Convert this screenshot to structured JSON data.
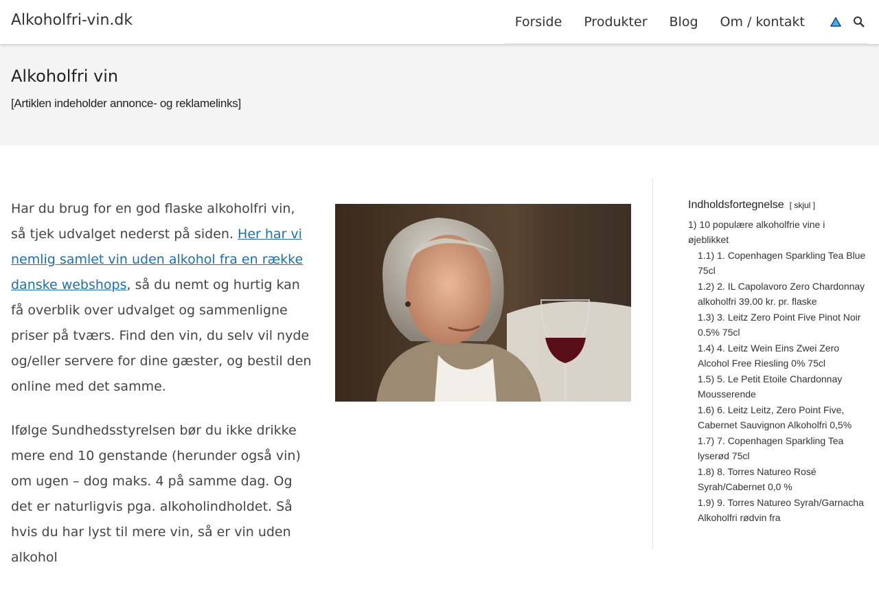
{
  "header": {
    "site_title": "Alkoholfri-vin.dk",
    "nav": [
      "Forside",
      "Produkter",
      "Blog",
      "Om / kontakt"
    ],
    "icons": {
      "alert": "warning-icon",
      "search": "search-icon"
    }
  },
  "hero": {
    "title": "Alkoholfri vin",
    "disclaimer": "[Artiklen indeholder annonce- og reklamelinks]"
  },
  "article": {
    "p1_before": "Har du brug for en god flaske alkoholfri vin, så tjek udvalget nederst på siden. ",
    "p1_link": "Her har vi nemlig samlet vin uden alkohol fra en række danske webshops",
    "p1_after": ", så du nemt og hurtig kan få overblik over udvalget og sammenligne priser på tværs. Find den vin, du selv vil nyde og/eller servere for dine gæster, og bestil den online med det samme.",
    "p2": "Ifølge Sundhedsstyrelsen bør du ikke drikke mere end 10 genstande (herunder også vin) om ugen – dog maks. 4 på samme dag. Og det er naturligvis pga. alkoholindholdet. Så hvis du har lyst til mere vin, så er vin uden alkohol"
  },
  "toc": {
    "title": "Indholdsfortegnelse",
    "toggle_open": "[",
    "toggle_label": "skjul",
    "toggle_close": "]",
    "items": [
      {
        "num": "1)",
        "text": "10 populære alkoholfrie vine i øjeblikket",
        "level": 1
      },
      {
        "num": "1.1)",
        "text": "1. Copenhagen Sparkling Tea Blue 75cl",
        "level": 2
      },
      {
        "num": "1.2)",
        "text": "2. IL Capolavoro Zero Chardonnay alkoholfri 39.00 kr. pr. flaske",
        "level": 2
      },
      {
        "num": "1.3)",
        "text": "3. Leitz Zero Point Five Pinot Noir 0.5% 75cl",
        "level": 2
      },
      {
        "num": "1.4)",
        "text": "4. Leitz Wein Eins Zwei Zero Alcohol Free Riesling 0% 75cl",
        "level": 2
      },
      {
        "num": "1.5)",
        "text": "5. Le Petit Etoile Chardonnay Mousserende",
        "level": 2
      },
      {
        "num": "1.6)",
        "text": "6. Leitz Leitz, Zero Point Five, Cabernet Sauvignon Alkoholfri 0,5%",
        "level": 2
      },
      {
        "num": "1.7)",
        "text": "7. Copenhagen Sparkling Tea lyserød 75cl",
        "level": 2
      },
      {
        "num": "1.8)",
        "text": "8. Torres Natureo Rosé Syrah/Cabernet 0,0 %",
        "level": 2
      },
      {
        "num": "1.9)",
        "text": "9. Torres Natureo Syrah/Garnacha Alkoholfri rødvin fra",
        "level": 2
      }
    ]
  }
}
